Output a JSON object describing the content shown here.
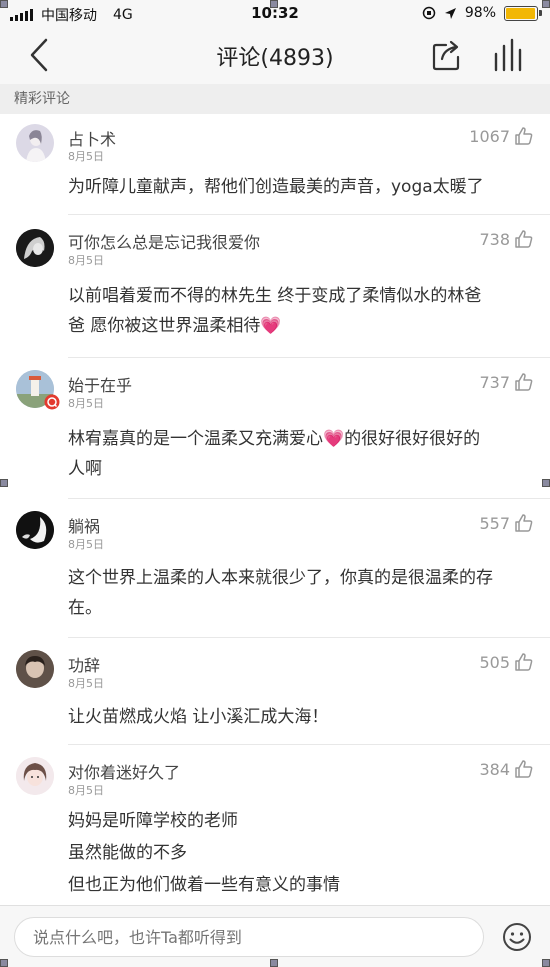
{
  "status": {
    "carrier": "中国移动",
    "network": "4G",
    "time": "10:32",
    "battery": "98%",
    "battery_level": 0.98
  },
  "nav": {
    "title": "评论(4893)"
  },
  "section": {
    "title": "精彩评论"
  },
  "comments": [
    {
      "user": "占卜术",
      "date": "8月5日",
      "likes": "1067",
      "lines": [
        "为听障儿童献声，帮他们创造最美的声音，yoga太暖了"
      ]
    },
    {
      "user": "可你怎么总是忘记我很爱你",
      "date": "8月5日",
      "likes": "738",
      "lines": [
        "以前唱着爱而不得的林先生  终于变成了柔情似水的林爸",
        "爸  愿你被这世界温柔相待"
      ]
    },
    {
      "user": "始于在乎",
      "date": "8月5日",
      "likes": "737",
      "lines": [
        "林宥嘉真的是一个温柔又充满爱心",
        "的很好很好很好的",
        "人啊"
      ]
    },
    {
      "user": "躺祸",
      "date": "8月5日",
      "likes": "557",
      "lines": [
        "这个世界上温柔的人本来就很少了，你真的是很温柔的存",
        "在。"
      ]
    },
    {
      "user": "功辞",
      "date": "8月5日",
      "likes": "505",
      "lines": [
        "让火苗燃成火焰 让小溪汇成大海！"
      ]
    },
    {
      "user": "对你着迷好久了",
      "date": "8月5日",
      "likes": "384",
      "lines": [
        "妈妈是听障学校的老师",
        "虽然能做的不多",
        "但也正为他们做着一些有意义的事情"
      ]
    }
  ],
  "input": {
    "placeholder": "说点什么吧，也许Ta都听得到"
  },
  "icons": {
    "back": "chevron-left-icon",
    "share": "share-icon",
    "stats": "equalizer-icon",
    "like": "thumbs-up-icon",
    "emoji": "smiley-icon",
    "heart": "heart-emoji"
  },
  "colors": {
    "heart": "#e060a0",
    "battery": "#f2b705"
  }
}
